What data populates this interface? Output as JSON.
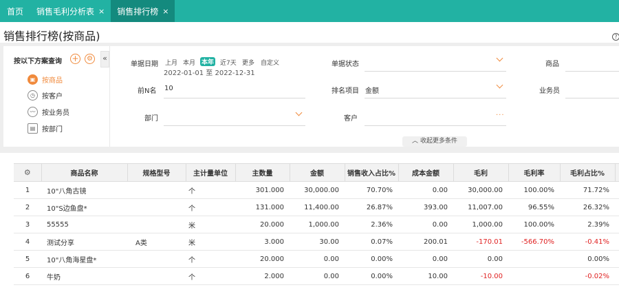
{
  "tabs": [
    {
      "label": "首页",
      "closable": false,
      "active": false
    },
    {
      "label": "销售毛利分析表",
      "closable": true,
      "active": false
    },
    {
      "label": "销售排行榜",
      "closable": true,
      "active": true
    }
  ],
  "close_glyph": "×",
  "page_title": "销售排行榜(按商品)",
  "help_glyph": "?",
  "scheme": {
    "title": "按以下方案查询",
    "add_glyph": "+",
    "settings_glyph": "⚙",
    "collapse_glyph": "«",
    "items": [
      {
        "label": "按商品",
        "icon": "box-icon",
        "glyph": "▣",
        "active": true
      },
      {
        "label": "按客户",
        "icon": "clock-icon",
        "glyph": "◷",
        "active": false
      },
      {
        "label": "按业务员",
        "icon": "chart-icon",
        "glyph": "〰",
        "active": false
      },
      {
        "label": "按部门",
        "icon": "dept-icon",
        "glyph": "▤",
        "active": false
      }
    ]
  },
  "filters": {
    "date_label": "单据日期",
    "date_chips": [
      {
        "label": "上月",
        "active": false
      },
      {
        "label": "本月",
        "active": false
      },
      {
        "label": "本年",
        "active": true
      },
      {
        "label": "近7天",
        "active": false
      },
      {
        "label": "更多",
        "active": false
      },
      {
        "label": "自定义",
        "active": false
      }
    ],
    "date_range": "2022-01-01 至 2022-12-31",
    "status_label": "单据状态",
    "status_value": "",
    "product_label": "商品",
    "topn_label": "前N名",
    "topn_value": "10",
    "rank_label": "排名项目",
    "rank_value": "金额",
    "salesman_label": "业务员",
    "dept_label": "部门",
    "dept_value": "",
    "customer_label": "客户",
    "customer_value": "",
    "more_label": "收起更多条件",
    "more_glyph": "︿",
    "dots_glyph": "···"
  },
  "table": {
    "settings_glyph": "⚙",
    "columns": [
      "商品名称",
      "规格型号",
      "主计量单位",
      "主数量",
      "金额",
      "销售收入占比%",
      "成本金额",
      "毛利",
      "毛利率",
      "毛利占比%"
    ],
    "rows": [
      {
        "idx": "1",
        "name": "10\"八角古镜",
        "spec": "",
        "unit": "个",
        "qty": "301.000",
        "amount": "30,000.00",
        "rev_pct": "70.70%",
        "cost": "0.00",
        "profit": "30,000.00",
        "margin": "100.00%",
        "profit_pct": "71.72%",
        "neg": false
      },
      {
        "idx": "2",
        "name": "10\"S边鱼盘*",
        "spec": "",
        "unit": "个",
        "qty": "131.000",
        "amount": "11,400.00",
        "rev_pct": "26.87%",
        "cost": "393.00",
        "profit": "11,007.00",
        "margin": "96.55%",
        "profit_pct": "26.32%",
        "neg": false
      },
      {
        "idx": "3",
        "name": "55555",
        "spec": "",
        "unit": "米",
        "qty": "20.000",
        "amount": "1,000.00",
        "rev_pct": "2.36%",
        "cost": "0.00",
        "profit": "1,000.00",
        "margin": "100.00%",
        "profit_pct": "2.39%",
        "neg": false
      },
      {
        "idx": "4",
        "name": "测试分享",
        "spec": "A类",
        "unit": "米",
        "qty": "3.000",
        "amount": "30.00",
        "rev_pct": "0.07%",
        "cost": "200.01",
        "profit": "-170.01",
        "margin": "-566.70%",
        "profit_pct": "-0.41%",
        "neg": true
      },
      {
        "idx": "5",
        "name": "10\"八角海星盘*",
        "spec": "",
        "unit": "个",
        "qty": "20.000",
        "amount": "0.00",
        "rev_pct": "0.00%",
        "cost": "0.00",
        "profit": "0.00",
        "margin": "",
        "profit_pct": "0.00%",
        "neg": false
      },
      {
        "idx": "6",
        "name": "牛奶",
        "spec": "",
        "unit": "个",
        "qty": "2.000",
        "amount": "0.00",
        "rev_pct": "0.00%",
        "cost": "10.00",
        "profit": "-10.00",
        "margin": "",
        "profit_pct": "-0.02%",
        "neg": true
      }
    ]
  },
  "colors": {
    "teal": "#22b2a3",
    "teal_dark": "#148a7e",
    "orange": "#f08a3c",
    "negative": "#e02020"
  }
}
